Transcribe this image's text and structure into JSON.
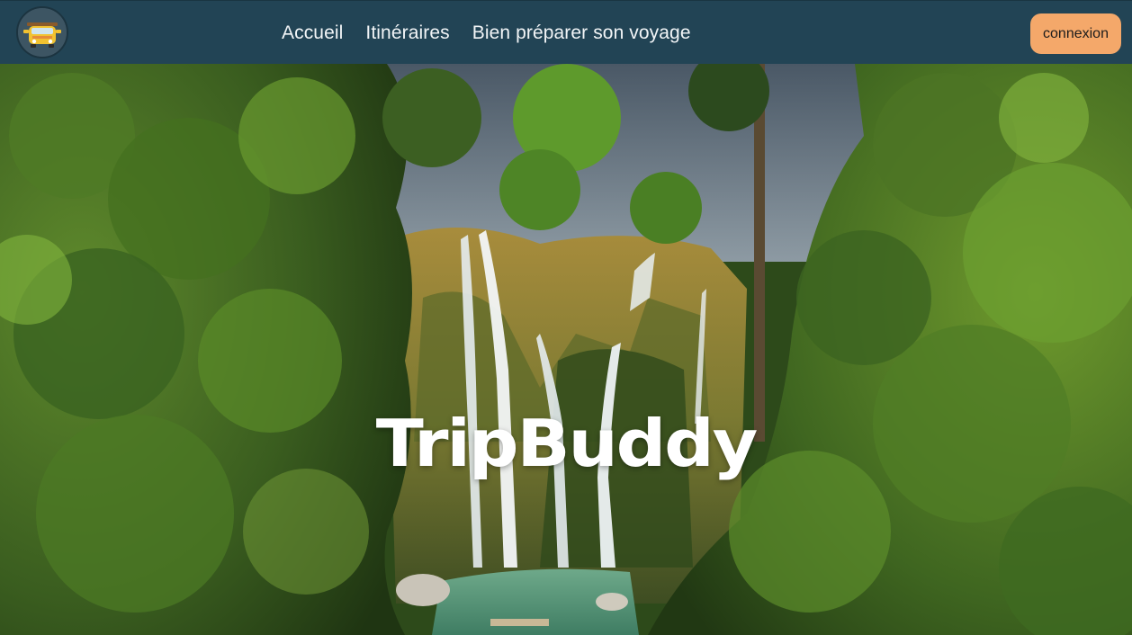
{
  "nav": {
    "logo_icon": "van-logo-icon",
    "links": [
      "Accueil",
      "Itinéraires",
      "Bien préparer son voyage"
    ],
    "login_label": "connexion"
  },
  "hero": {
    "title": "TripBuddy",
    "image": "jungle-waterfall-photo"
  },
  "colors": {
    "navbar_bg": "#224455",
    "login_button_bg": "#f4a86a",
    "title_color": "#ffffff"
  }
}
